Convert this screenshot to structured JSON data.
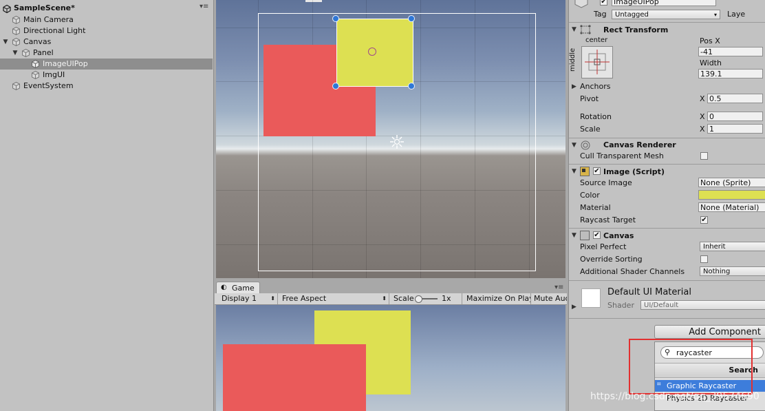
{
  "hierarchy": {
    "scene_title": "SampleScene*",
    "items": [
      {
        "label": "Main Camera"
      },
      {
        "label": "Directional Light"
      },
      {
        "label": "Canvas"
      },
      {
        "label": "Panel"
      },
      {
        "label": "ImageUIPop"
      },
      {
        "label": "ImgUI"
      },
      {
        "label": "EventSystem"
      }
    ],
    "selected": "ImageUIPop"
  },
  "game": {
    "tab_label": "Game",
    "display": "Display 1",
    "aspect": "Free Aspect",
    "scale_label": "Scale",
    "scale_value": "1x",
    "maximize": "Maximize On Play",
    "mute": "Mute Aud"
  },
  "inspector": {
    "object_name": "ImageUIPop",
    "tag_label": "Tag",
    "tag_value": "Untagged",
    "layer_label": "Laye",
    "rect_transform": {
      "title": "Rect Transform",
      "anchor_h": "center",
      "anchor_v": "middle",
      "posx_label": "Pos X",
      "posx_value": "-41",
      "width_label": "Width",
      "width_value": "139.1",
      "anchors_label": "Anchors",
      "pivot_label": "Pivot",
      "pivot_x_label": "X",
      "pivot_x_value": "0.5",
      "rotation_label": "Rotation",
      "rotation_x_label": "X",
      "rotation_x_value": "0",
      "scale_label": "Scale",
      "scale_x_label": "X",
      "scale_x_value": "1"
    },
    "canvas_renderer": {
      "title": "Canvas Renderer",
      "cull_label": "Cull Transparent Mesh",
      "cull_checked": false
    },
    "image": {
      "title": "Image (Script)",
      "source_label": "Source Image",
      "source_value": "None (Sprite)",
      "color_label": "Color",
      "color_value": "#dde052",
      "material_label": "Material",
      "material_value": "None (Material)",
      "raycast_label": "Raycast Target",
      "raycast_checked": true
    },
    "canvas": {
      "title": "Canvas",
      "pixel_perfect_label": "Pixel Perfect",
      "pixel_perfect_value": "Inherit",
      "override_label": "Override Sorting",
      "override_checked": false,
      "shader_channels_label": "Additional Shader Channels",
      "shader_channels_value": "Nothing"
    },
    "material": {
      "name": "Default UI Material",
      "shader_label": "Shader",
      "shader_value": "UI/Default"
    },
    "add_component": {
      "button_label": "Add Component",
      "search_value": "raycaster",
      "header": "Search",
      "results": [
        {
          "label": "Graphic Raycaster"
        },
        {
          "label": "Physics 2D Raycaster"
        }
      ]
    }
  },
  "watermark": "https://blog.csdn.net/qq_39574690",
  "colors": {
    "image_red": "#ea5a5a",
    "image_yellow": "#dde052",
    "selection_blue": "#3d7ddb",
    "highlight_red": "#e23030"
  }
}
